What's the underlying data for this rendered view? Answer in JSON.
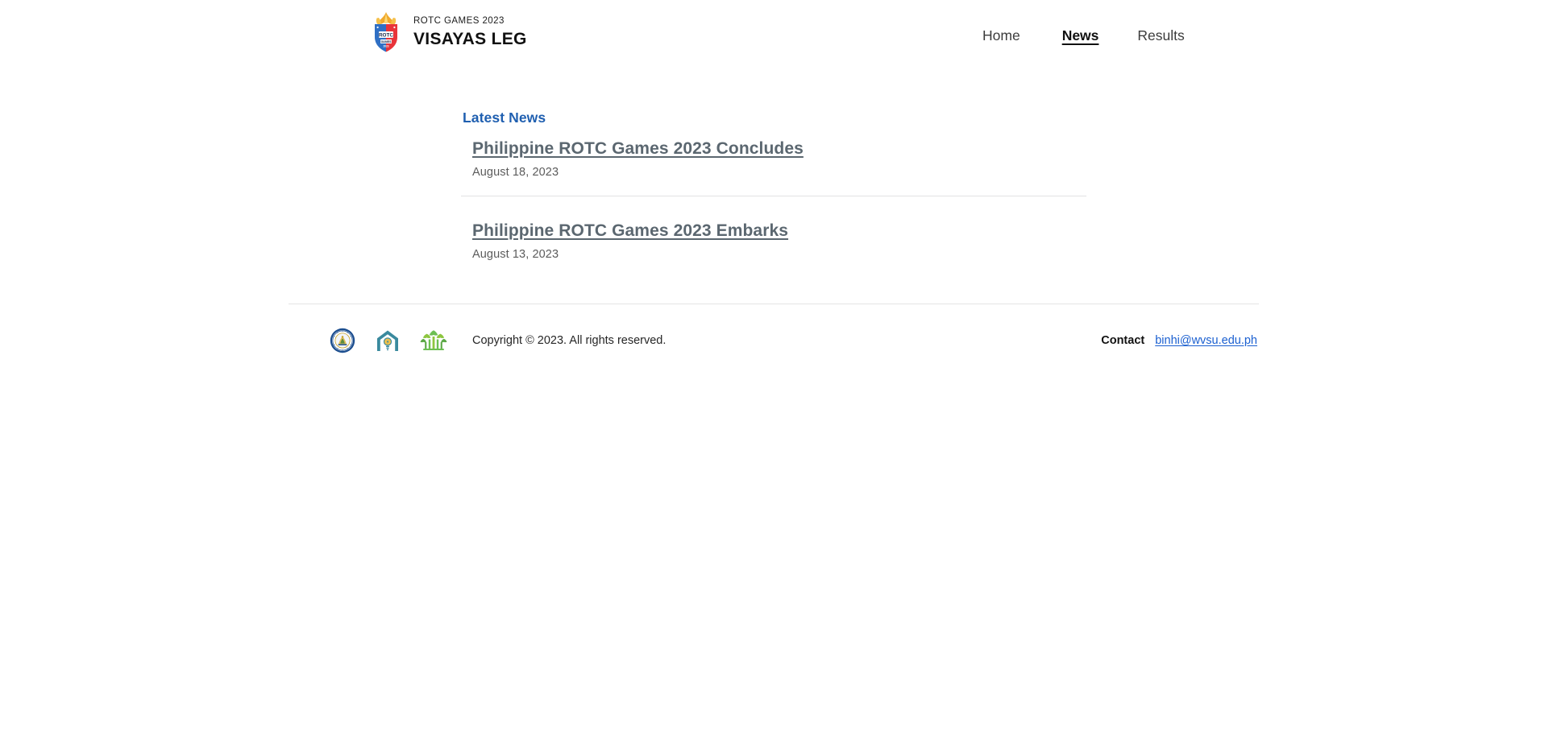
{
  "header": {
    "brand": {
      "logo_icon": "rotc-shield-flame-logo",
      "kicker": "ROTC GAMES 2023",
      "title": "VISAYAS LEG"
    },
    "nav": {
      "items": [
        {
          "label": "Home",
          "active": false
        },
        {
          "label": "News",
          "active": true
        },
        {
          "label": "Results",
          "active": false
        }
      ]
    }
  },
  "main": {
    "section_title": "Latest News",
    "news": [
      {
        "title": "Philippine ROTC Games 2023 Concludes",
        "date": "August 18, 2023"
      },
      {
        "title": "Philippine ROTC Games 2023 Embarks",
        "date": "August 13, 2023"
      }
    ]
  },
  "footer": {
    "logos": [
      {
        "icon": "wvsu-university-seal-icon",
        "name": "West Visayas State University seal"
      },
      {
        "icon": "house-lightbulb-icon",
        "name": "Innovation hub logo"
      },
      {
        "icon": "green-plant-icon",
        "name": "Binhi green plant logo"
      }
    ],
    "copyright": "Copyright © 2023. All rights reserved.",
    "contact_label": "Contact",
    "contact_email": "binhi@wvsu.edu.ph"
  },
  "colors": {
    "section_title": "#1f5fb0",
    "news_title": "#5b6770",
    "link_blue": "#1a5fd0",
    "divider": "#e2e2e3",
    "logo_red": "#e8343a",
    "logo_blue": "#2f6fc4",
    "logo_gold": "#f2b632",
    "seal_blue": "#1c4e8f",
    "house_teal": "#3a8a9e",
    "bulb_yellow": "#f2c14a",
    "plant_green": "#6cbf52"
  }
}
